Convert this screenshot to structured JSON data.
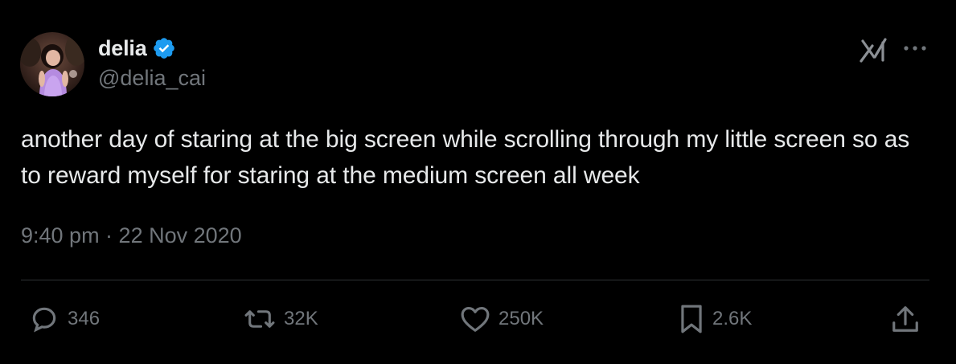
{
  "tweet": {
    "display_name": "delia",
    "handle": "@delia_cai",
    "verified": true,
    "text": "another day of staring at the big screen while scrolling through my little screen so as to reward myself for staring at the medium screen all week",
    "timestamp": "9:40 pm · 22 Nov 2020",
    "stats": {
      "replies": "346",
      "reposts": "32K",
      "likes": "250K",
      "bookmarks": "2.6K"
    }
  },
  "colors": {
    "background": "#000000",
    "text_primary": "#e7e9ea",
    "text_secondary": "#71767b",
    "verified_badge": "#1d9bf0",
    "divider": "#2f3336"
  },
  "icons": {
    "verified": "verified-badge-icon",
    "logo": "x-logo-icon",
    "more": "more-options-icon",
    "reply": "reply-bubble-icon",
    "repost": "repost-icon",
    "like": "heart-icon",
    "bookmark": "bookmark-icon",
    "share": "share-icon"
  }
}
